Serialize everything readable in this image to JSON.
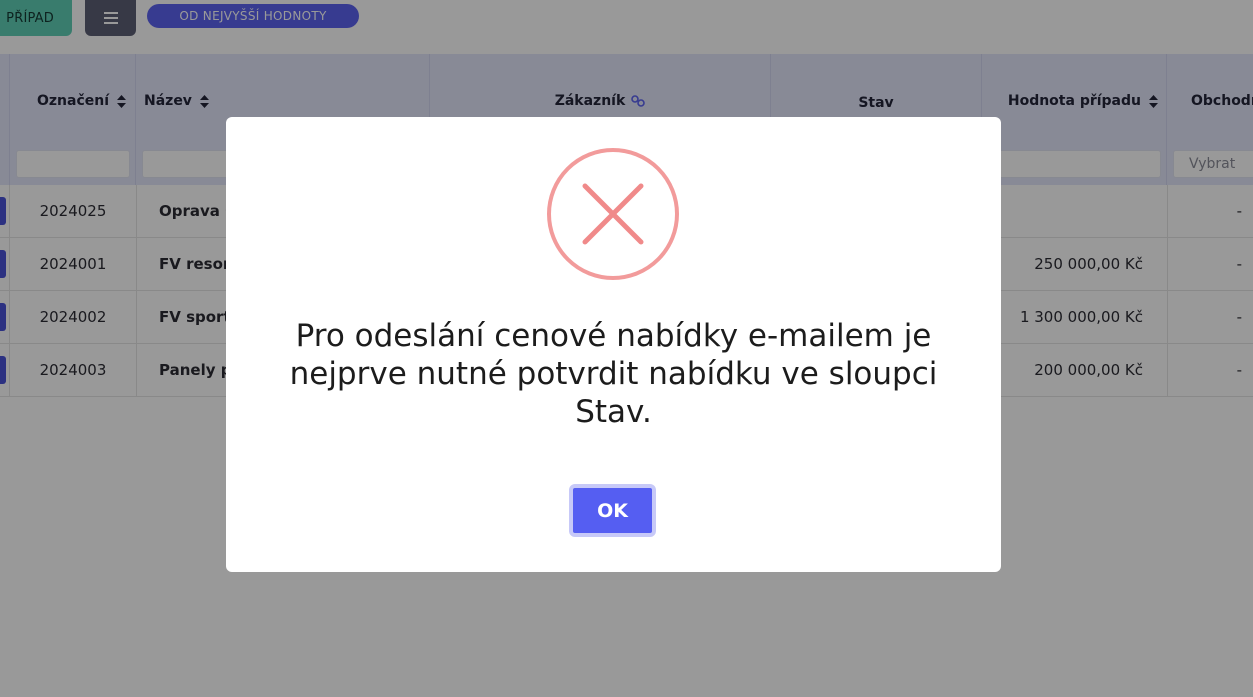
{
  "toolbar": {
    "case_button": "PŘÍPAD",
    "menu_icon": "hamburger-icon",
    "sort_label": "OD NEJVYŠŠÍ HODNOTY"
  },
  "table": {
    "columns": [
      {
        "label": "Označení",
        "icon": "sort-icon"
      },
      {
        "label": "Název",
        "icon": "sort-icon"
      },
      {
        "label": "Zákazník",
        "icon": "link-icon"
      },
      {
        "label": "Stav",
        "icon": ""
      },
      {
        "label": "Hodnota případu",
        "icon": "sort-icon"
      },
      {
        "label": "Obchodní"
      }
    ],
    "filter_select_placeholder": "Vybrat",
    "rows": [
      {
        "id": "2024025",
        "name": "Oprava s",
        "value": "",
        "extra": "-"
      },
      {
        "id": "2024001",
        "name": "FV resor",
        "value": "250 000,00 Kč",
        "extra": "-"
      },
      {
        "id": "2024002",
        "name": "FV sport",
        "value": "1 300 000,00 Kč",
        "extra": "-"
      },
      {
        "id": "2024003",
        "name": "Panely p",
        "value": "200 000,00 Kč",
        "extra": "-"
      }
    ]
  },
  "dialog": {
    "icon": "error-x-icon",
    "message": "Pro odeslání cenové nabídky e-mailem je nejprve nutné potvrdit nabídku ve sloupci Stav.",
    "ok_label": "OK"
  },
  "colors": {
    "accent": "#555ef2",
    "teal": "#5fcfb6",
    "error": "#f08a8a"
  }
}
